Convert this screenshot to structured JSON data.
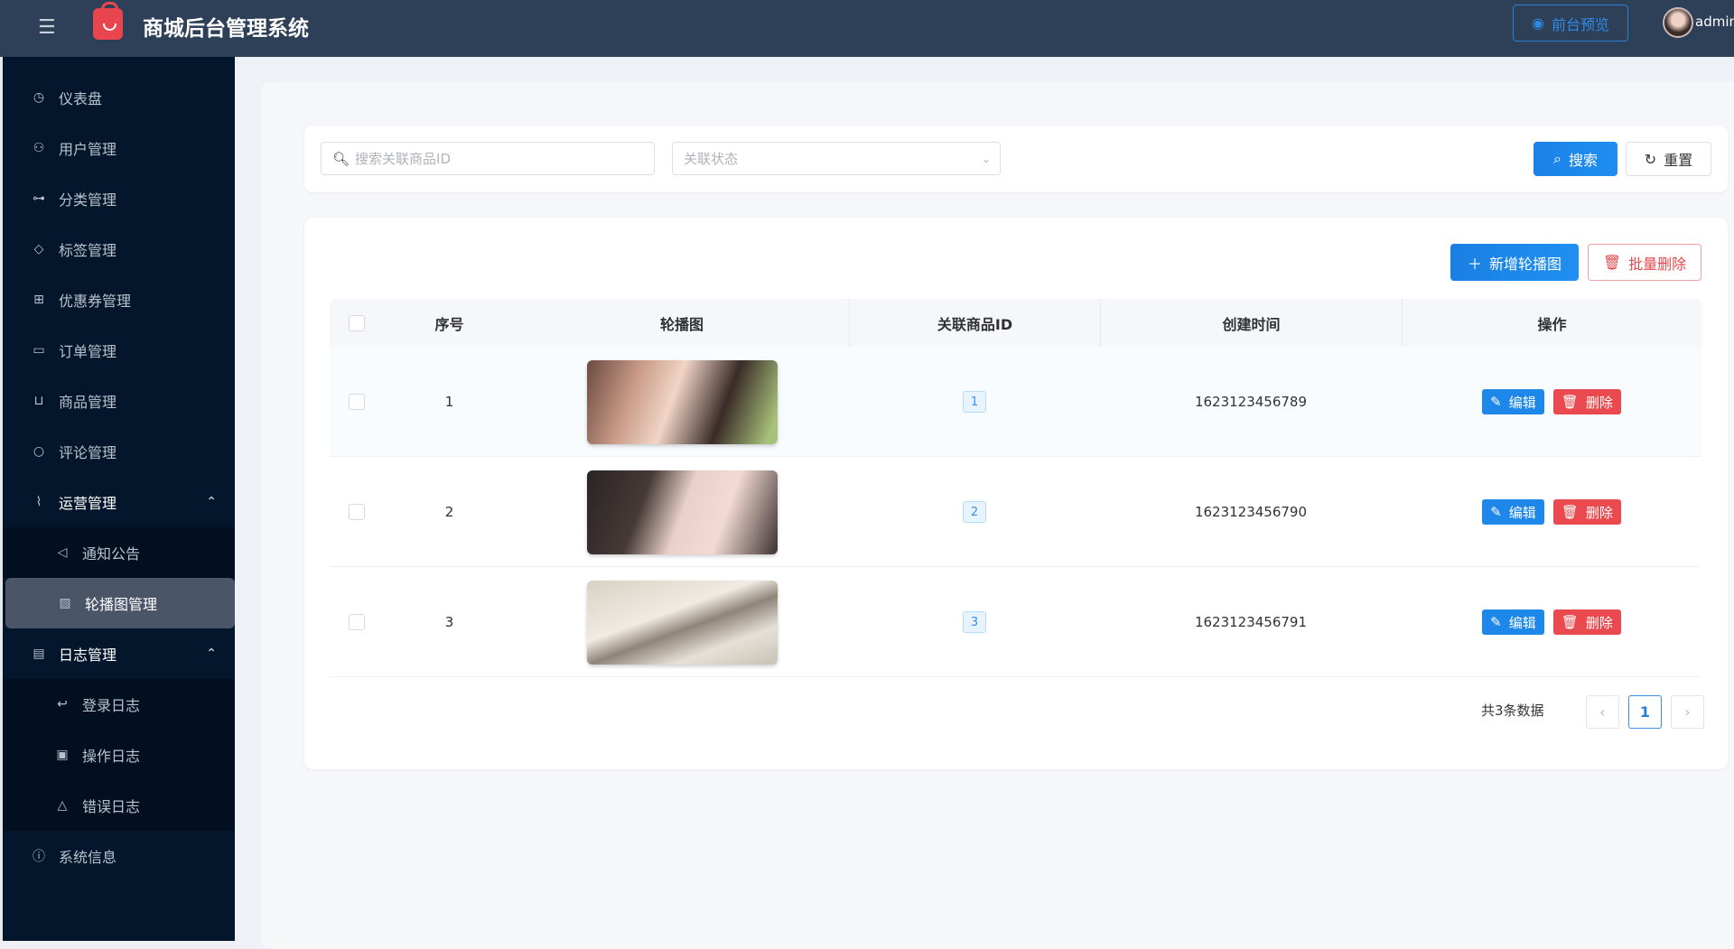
{
  "header": {
    "title": "商城后台管理系统",
    "preview_label": "前台预览",
    "username": "admin"
  },
  "sidebar": {
    "items": [
      {
        "label": "仪表盘",
        "icon": "dashboard-icon"
      },
      {
        "label": "用户管理",
        "icon": "user-icon"
      },
      {
        "label": "分类管理",
        "icon": "category-icon"
      },
      {
        "label": "标签管理",
        "icon": "tag-icon"
      },
      {
        "label": "优惠券管理",
        "icon": "gift-icon"
      },
      {
        "label": "订单管理",
        "icon": "bag-icon"
      },
      {
        "label": "商品管理",
        "icon": "cart-icon"
      },
      {
        "label": "评论管理",
        "icon": "comment-icon"
      },
      {
        "label": "运营管理",
        "icon": "chart-icon",
        "expanded": true
      },
      {
        "label": "通知公告",
        "icon": "megaphone-icon"
      },
      {
        "label": "轮播图管理",
        "icon": "image-icon",
        "active": true
      },
      {
        "label": "日志管理",
        "icon": "document-icon",
        "expanded": true
      },
      {
        "label": "登录日志",
        "icon": "login-icon"
      },
      {
        "label": "操作日志",
        "icon": "operation-icon"
      },
      {
        "label": "错误日志",
        "icon": "warning-icon"
      },
      {
        "label": "系统信息",
        "icon": "info-icon"
      }
    ]
  },
  "search": {
    "product_id_placeholder": "搜索关联商品ID",
    "status_placeholder": "关联状态",
    "search_label": "搜索",
    "reset_label": "重置"
  },
  "toolbar": {
    "add_label": "新增轮播图",
    "batch_delete_label": "批量删除"
  },
  "table": {
    "columns": [
      "序号",
      "轮播图",
      "关联商品ID",
      "创建时间",
      "操作"
    ],
    "rows": [
      {
        "index": "1",
        "product_id": "1",
        "created": "1623123456789"
      },
      {
        "index": "2",
        "product_id": "2",
        "created": "1623123456790"
      },
      {
        "index": "3",
        "product_id": "3",
        "created": "1623123456791"
      }
    ],
    "edit_label": "编辑",
    "delete_label": "删除"
  },
  "pagination": {
    "total_text": "共3条数据",
    "current_page": "1"
  },
  "colors": {
    "primary": "#1a85ea",
    "danger": "#ea4a4f",
    "sidebar": "#03162b",
    "header": "#2e4058"
  }
}
